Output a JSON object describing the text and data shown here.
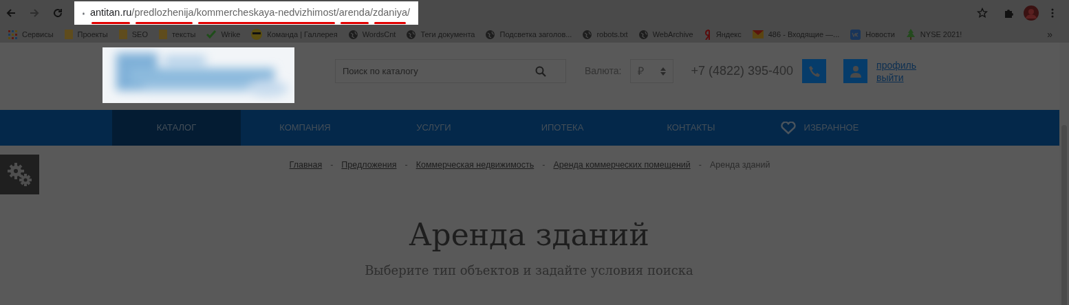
{
  "browser": {
    "url": [
      {
        "text": "antitan.ru",
        "kind": "host",
        "marked": true
      },
      {
        "text": "/",
        "kind": "path",
        "marked": false
      },
      {
        "text": "predlozhenija",
        "kind": "path",
        "marked": true
      },
      {
        "text": "/",
        "kind": "path",
        "marked": false
      },
      {
        "text": "kommercheskaya-nedvizhimost",
        "kind": "path",
        "marked": true
      },
      {
        "text": "/",
        "kind": "path",
        "marked": false
      },
      {
        "text": "arenda",
        "kind": "path",
        "marked": true
      },
      {
        "text": "/",
        "kind": "path",
        "marked": false
      },
      {
        "text": "zdaniya",
        "kind": "path",
        "marked": true
      },
      {
        "text": "/",
        "kind": "path",
        "marked": false
      }
    ],
    "bookmarks": [
      {
        "label": "Сервисы",
        "kind": "apps"
      },
      {
        "label": "Проекты",
        "kind": "folder"
      },
      {
        "label": "SEO",
        "kind": "folder"
      },
      {
        "label": "тексты",
        "kind": "folder"
      },
      {
        "label": "Wrike",
        "kind": "check"
      },
      {
        "label": "Команда | Галлерея",
        "kind": "smiley"
      },
      {
        "label": "WordsCnt",
        "kind": "globe"
      },
      {
        "label": "Теги документа",
        "kind": "globe"
      },
      {
        "label": "Подсветка заголов...",
        "kind": "globe"
      },
      {
        "label": "robots.txt",
        "kind": "globe"
      },
      {
        "label": "WebArchive",
        "kind": "globe"
      },
      {
        "label": "Яндекс",
        "kind": "yandex"
      },
      {
        "label": "486 - Входящие —...",
        "kind": "mail"
      },
      {
        "label": "Новости",
        "kind": "vk"
      },
      {
        "label": "NYSE 2021!",
        "kind": "tree"
      }
    ],
    "overflow": "»"
  },
  "header": {
    "search": {
      "placeholder": "Поиск по каталогу"
    },
    "currency_label": "Валюта:",
    "currency": "₽",
    "phone": "+7 (4822) 395-400",
    "links": [
      "профиль",
      "выйти"
    ]
  },
  "nav": [
    {
      "label": "КАТАЛОГ",
      "selected": true
    },
    {
      "label": "КОМПАНИЯ",
      "selected": false
    },
    {
      "label": "УСЛУГИ",
      "selected": false
    },
    {
      "label": "ИПОТЕКА",
      "selected": false
    },
    {
      "label": "КОНТАКТЫ",
      "selected": false
    },
    {
      "label": "ИЗБРАННОЕ",
      "selected": false,
      "kind": "favorites"
    }
  ],
  "breadcrumbs": [
    {
      "label": "Главная",
      "link": true
    },
    {
      "label": "Предложения",
      "link": true
    },
    {
      "label": "Коммерческая недвижимость",
      "link": true
    },
    {
      "label": "Аренда коммерческих помещений",
      "link": true
    },
    {
      "label": "Аренда зданий",
      "link": false
    }
  ],
  "breadcrumb_separator": "-",
  "title": "Аренда зданий",
  "subtitle": "Выберите тип объектов и задайте условия поиска"
}
